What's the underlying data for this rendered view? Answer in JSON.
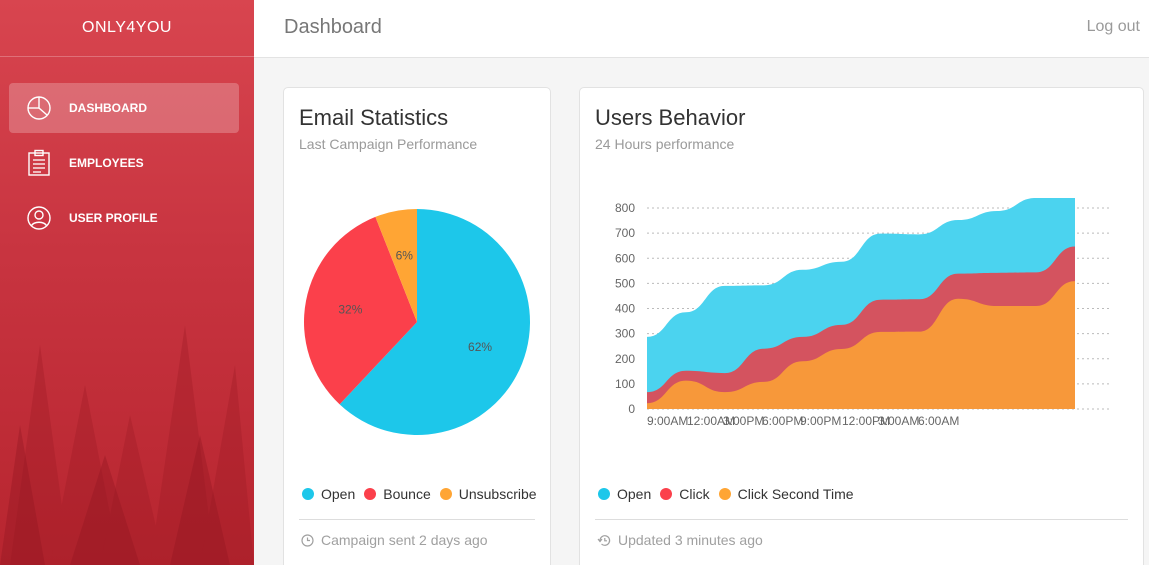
{
  "brand": "ONLY4YOU",
  "sidebar": {
    "items": [
      {
        "label": "DASHBOARD",
        "icon": "pie-chart-icon",
        "active": true
      },
      {
        "label": "EMPLOYEES",
        "icon": "clipboard-icon",
        "active": false
      },
      {
        "label": "USER PROFILE",
        "icon": "user-icon",
        "active": false
      }
    ]
  },
  "header": {
    "title": "Dashboard",
    "logout": "Log out"
  },
  "email_card": {
    "title": "Email Statistics",
    "subtitle": "Last Campaign Performance",
    "legend": [
      "Open",
      "Bounce",
      "Unsubscribe"
    ],
    "footer": "Campaign sent 2 days ago"
  },
  "behavior_card": {
    "title": "Users Behavior",
    "subtitle": "24 Hours performance",
    "legend": [
      "Open",
      "Click",
      "Click Second Time"
    ],
    "footer": "Updated 3 minutes ago"
  },
  "colors": {
    "open": "#1dc7ea",
    "bounce": "#fb404b",
    "unsubscribe": "#ffa534",
    "click_area": "#d4535f",
    "second_area": "#f7983a",
    "open_area": "#4bd3ef"
  },
  "chart_data": [
    {
      "type": "pie",
      "categories": [
        "Open",
        "Bounce",
        "Unsubscribe"
      ],
      "values": [
        62,
        32,
        6
      ],
      "labels": [
        "62%",
        "32%",
        "6%"
      ]
    },
    {
      "type": "area",
      "x": [
        "9:00AM",
        "12:00AM",
        "3:00PM",
        "6:00PM",
        "9:00PM",
        "12:00PM",
        "3:00AM",
        "6:00AM"
      ],
      "series": [
        {
          "name": "Open",
          "values": [
            287,
            385,
            490,
            492,
            554,
            586,
            698,
            695,
            752,
            788,
            846,
            846
          ]
        },
        {
          "name": "Click",
          "values": [
            67,
            152,
            143,
            240,
            287,
            335,
            435,
            437,
            539,
            542,
            544,
            647
          ]
        },
        {
          "name": "Click Second Time",
          "values": [
            23,
            113,
            67,
            108,
            190,
            239,
            307,
            308,
            439,
            410,
            410,
            509
          ]
        }
      ],
      "ylim": [
        0,
        800
      ],
      "yticks": [
        "0",
        "100",
        "200",
        "300",
        "400",
        "500",
        "600",
        "700",
        "800"
      ],
      "grid": true
    }
  ]
}
